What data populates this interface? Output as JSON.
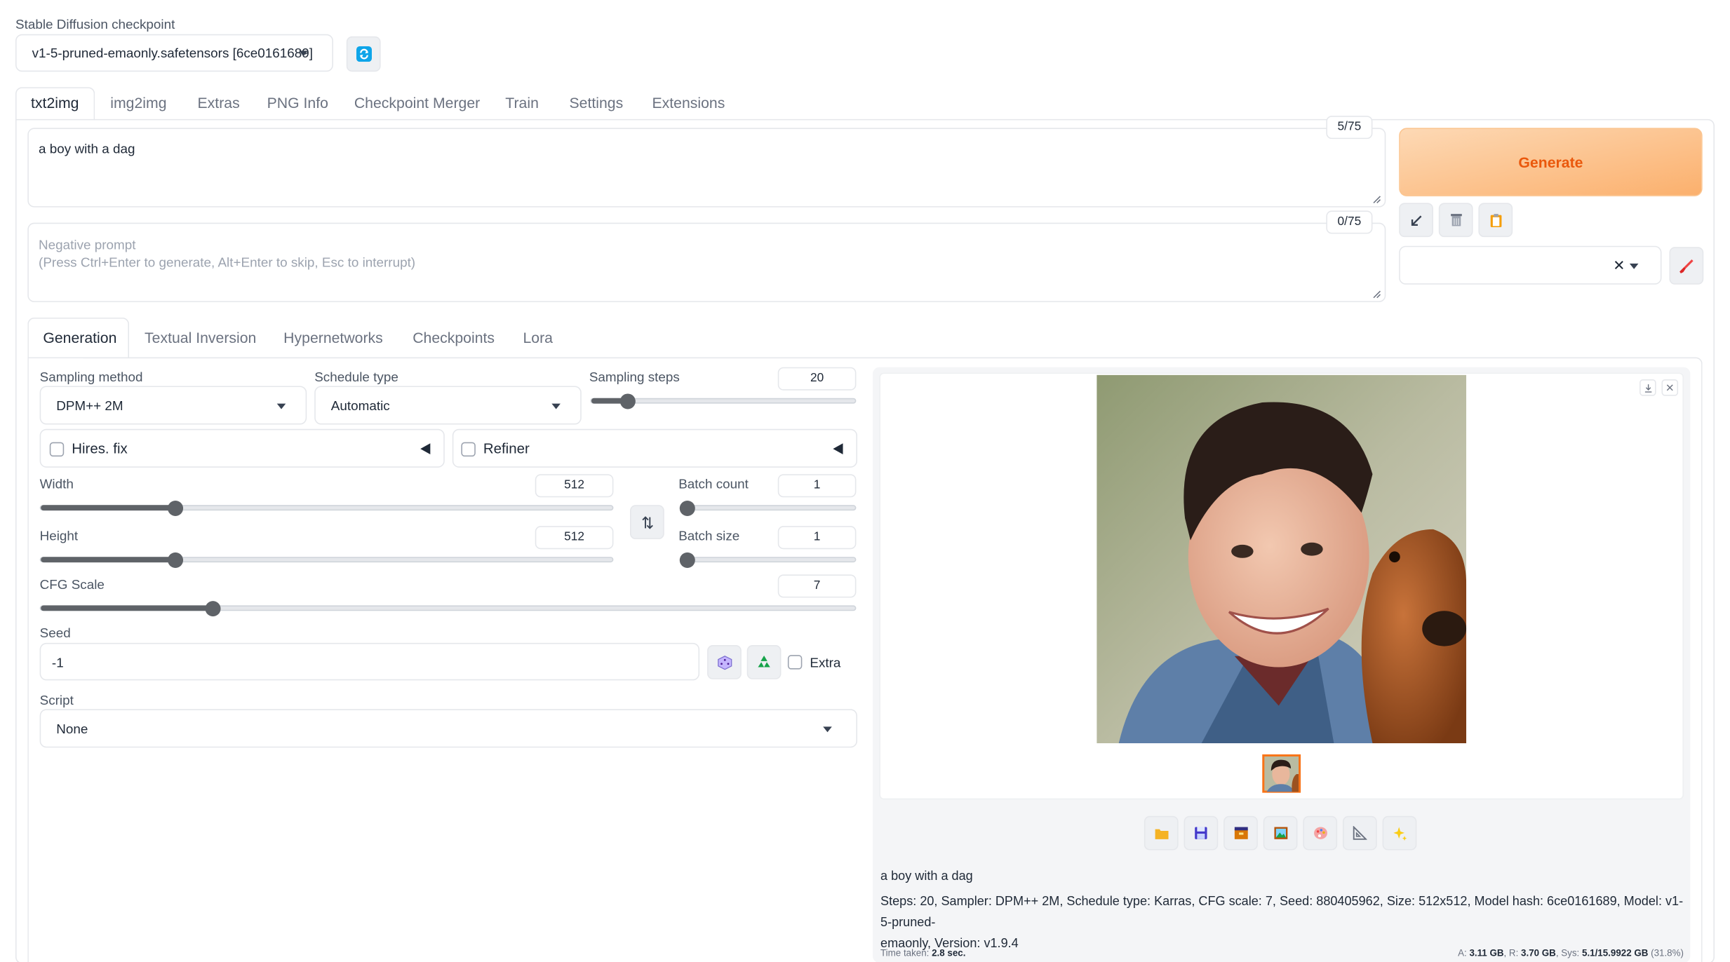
{
  "checkpoint": {
    "label": "Stable Diffusion checkpoint",
    "value": "v1-5-pruned-emaonly.safetensors [6ce0161689]"
  },
  "main_tabs": [
    "txt2img",
    "img2img",
    "Extras",
    "PNG Info",
    "Checkpoint Merger",
    "Train",
    "Settings",
    "Extensions"
  ],
  "prompt": {
    "value": "a boy with a dag",
    "token_count": "5/75"
  },
  "negative_prompt": {
    "placeholder": "Negative prompt\n(Press Ctrl+Enter to generate, Alt+Enter to skip, Esc to interrupt)",
    "line1": "Negative prompt",
    "line2": "(Press Ctrl+Enter to generate, Alt+Enter to skip, Esc to interrupt)",
    "token_count": "0/75"
  },
  "generate_label": "Generate",
  "styles_clear_symbol": "✕",
  "sub_tabs": [
    "Generation",
    "Textual Inversion",
    "Hypernetworks",
    "Checkpoints",
    "Lora"
  ],
  "sampling_method": {
    "label": "Sampling method",
    "value": "DPM++ 2M"
  },
  "schedule_type": {
    "label": "Schedule type",
    "value": "Automatic"
  },
  "sampling_steps": {
    "label": "Sampling steps",
    "value": "20",
    "fraction": 0.14
  },
  "hires_fix": {
    "label": "Hires. fix",
    "checked": false
  },
  "refiner": {
    "label": "Refiner",
    "checked": false
  },
  "width": {
    "label": "Width",
    "value": "512",
    "fraction": 0.235
  },
  "height": {
    "label": "Height",
    "value": "512",
    "fraction": 0.235
  },
  "batch_count": {
    "label": "Batch count",
    "value": "1",
    "fraction": 0.0
  },
  "batch_size": {
    "label": "Batch size",
    "value": "1",
    "fraction": 0.0
  },
  "cfg_scale": {
    "label": "CFG Scale",
    "value": "7",
    "fraction": 0.212
  },
  "seed": {
    "label": "Seed",
    "value": "-1"
  },
  "extra_label": "Extra",
  "script": {
    "label": "Script",
    "value": "None"
  },
  "output": {
    "prompt_text": "a boy with a dag",
    "params_line1": "Steps: 20, Sampler: DPM++ 2M, Schedule type: Karras, CFG scale: 7, Seed: 880405962, Size: 512x512, Model hash: 6ce0161689, Model: v1-5-pruned-",
    "params_line2": "emaonly, Version: v1.9.4",
    "time_label": "Time taken:",
    "time_value": "2.8 sec.",
    "mem_a_label": "A:",
    "mem_a_value": "3.11 GB",
    "mem_r_label": ", R:",
    "mem_r_value": "3.70 GB",
    "mem_sys_label": ", Sys:",
    "mem_sys_value": "5.1/15.9922 GB",
    "mem_pct": "(31.8%)"
  },
  "colors": {
    "generate_start": "#fdd7b1",
    "generate_end": "#fcb572",
    "generate_text": "#ea580c",
    "accent_blue": "#0ea5e9",
    "thumb_border": "#f97316"
  }
}
